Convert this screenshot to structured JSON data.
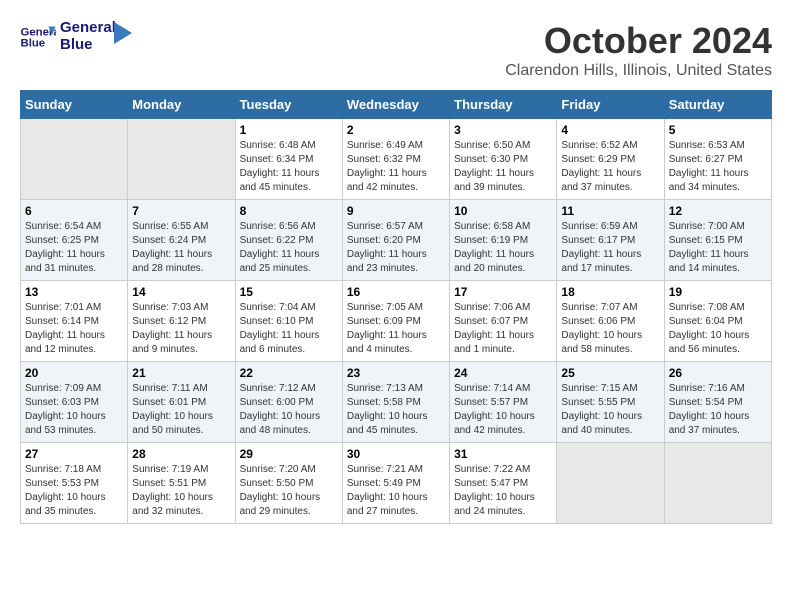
{
  "header": {
    "logo_line1": "General",
    "logo_line2": "Blue",
    "month": "October 2024",
    "location": "Clarendon Hills, Illinois, United States"
  },
  "days_of_week": [
    "Sunday",
    "Monday",
    "Tuesday",
    "Wednesday",
    "Thursday",
    "Friday",
    "Saturday"
  ],
  "weeks": [
    [
      {
        "day": "",
        "info": ""
      },
      {
        "day": "",
        "info": ""
      },
      {
        "day": "1",
        "info": "Sunrise: 6:48 AM\nSunset: 6:34 PM\nDaylight: 11 hours and 45 minutes."
      },
      {
        "day": "2",
        "info": "Sunrise: 6:49 AM\nSunset: 6:32 PM\nDaylight: 11 hours and 42 minutes."
      },
      {
        "day": "3",
        "info": "Sunrise: 6:50 AM\nSunset: 6:30 PM\nDaylight: 11 hours and 39 minutes."
      },
      {
        "day": "4",
        "info": "Sunrise: 6:52 AM\nSunset: 6:29 PM\nDaylight: 11 hours and 37 minutes."
      },
      {
        "day": "5",
        "info": "Sunrise: 6:53 AM\nSunset: 6:27 PM\nDaylight: 11 hours and 34 minutes."
      }
    ],
    [
      {
        "day": "6",
        "info": "Sunrise: 6:54 AM\nSunset: 6:25 PM\nDaylight: 11 hours and 31 minutes."
      },
      {
        "day": "7",
        "info": "Sunrise: 6:55 AM\nSunset: 6:24 PM\nDaylight: 11 hours and 28 minutes."
      },
      {
        "day": "8",
        "info": "Sunrise: 6:56 AM\nSunset: 6:22 PM\nDaylight: 11 hours and 25 minutes."
      },
      {
        "day": "9",
        "info": "Sunrise: 6:57 AM\nSunset: 6:20 PM\nDaylight: 11 hours and 23 minutes."
      },
      {
        "day": "10",
        "info": "Sunrise: 6:58 AM\nSunset: 6:19 PM\nDaylight: 11 hours and 20 minutes."
      },
      {
        "day": "11",
        "info": "Sunrise: 6:59 AM\nSunset: 6:17 PM\nDaylight: 11 hours and 17 minutes."
      },
      {
        "day": "12",
        "info": "Sunrise: 7:00 AM\nSunset: 6:15 PM\nDaylight: 11 hours and 14 minutes."
      }
    ],
    [
      {
        "day": "13",
        "info": "Sunrise: 7:01 AM\nSunset: 6:14 PM\nDaylight: 11 hours and 12 minutes."
      },
      {
        "day": "14",
        "info": "Sunrise: 7:03 AM\nSunset: 6:12 PM\nDaylight: 11 hours and 9 minutes."
      },
      {
        "day": "15",
        "info": "Sunrise: 7:04 AM\nSunset: 6:10 PM\nDaylight: 11 hours and 6 minutes."
      },
      {
        "day": "16",
        "info": "Sunrise: 7:05 AM\nSunset: 6:09 PM\nDaylight: 11 hours and 4 minutes."
      },
      {
        "day": "17",
        "info": "Sunrise: 7:06 AM\nSunset: 6:07 PM\nDaylight: 11 hours and 1 minute."
      },
      {
        "day": "18",
        "info": "Sunrise: 7:07 AM\nSunset: 6:06 PM\nDaylight: 10 hours and 58 minutes."
      },
      {
        "day": "19",
        "info": "Sunrise: 7:08 AM\nSunset: 6:04 PM\nDaylight: 10 hours and 56 minutes."
      }
    ],
    [
      {
        "day": "20",
        "info": "Sunrise: 7:09 AM\nSunset: 6:03 PM\nDaylight: 10 hours and 53 minutes."
      },
      {
        "day": "21",
        "info": "Sunrise: 7:11 AM\nSunset: 6:01 PM\nDaylight: 10 hours and 50 minutes."
      },
      {
        "day": "22",
        "info": "Sunrise: 7:12 AM\nSunset: 6:00 PM\nDaylight: 10 hours and 48 minutes."
      },
      {
        "day": "23",
        "info": "Sunrise: 7:13 AM\nSunset: 5:58 PM\nDaylight: 10 hours and 45 minutes."
      },
      {
        "day": "24",
        "info": "Sunrise: 7:14 AM\nSunset: 5:57 PM\nDaylight: 10 hours and 42 minutes."
      },
      {
        "day": "25",
        "info": "Sunrise: 7:15 AM\nSunset: 5:55 PM\nDaylight: 10 hours and 40 minutes."
      },
      {
        "day": "26",
        "info": "Sunrise: 7:16 AM\nSunset: 5:54 PM\nDaylight: 10 hours and 37 minutes."
      }
    ],
    [
      {
        "day": "27",
        "info": "Sunrise: 7:18 AM\nSunset: 5:53 PM\nDaylight: 10 hours and 35 minutes."
      },
      {
        "day": "28",
        "info": "Sunrise: 7:19 AM\nSunset: 5:51 PM\nDaylight: 10 hours and 32 minutes."
      },
      {
        "day": "29",
        "info": "Sunrise: 7:20 AM\nSunset: 5:50 PM\nDaylight: 10 hours and 29 minutes."
      },
      {
        "day": "30",
        "info": "Sunrise: 7:21 AM\nSunset: 5:49 PM\nDaylight: 10 hours and 27 minutes."
      },
      {
        "day": "31",
        "info": "Sunrise: 7:22 AM\nSunset: 5:47 PM\nDaylight: 10 hours and 24 minutes."
      },
      {
        "day": "",
        "info": ""
      },
      {
        "day": "",
        "info": ""
      }
    ]
  ]
}
